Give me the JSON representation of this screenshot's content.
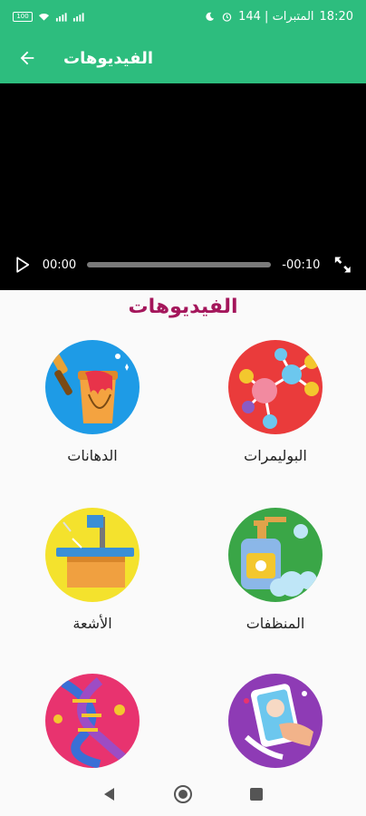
{
  "status_bar": {
    "time": "18:20",
    "carrier": "144 | المتبرات",
    "battery": "100"
  },
  "app_bar": {
    "title": "الفيديوهات",
    "back_icon": "arrow-left-icon"
  },
  "player": {
    "current_time": "00:00",
    "remaining_time": "-00:10",
    "progress": 0,
    "play_icon": "play-icon",
    "fullscreen_icon": "fullscreen-icon"
  },
  "section": {
    "title": "الفيديوهات"
  },
  "categories": [
    {
      "label": "الدهانات",
      "icon": "paint-bucket-icon",
      "color": "#1e9be6"
    },
    {
      "label": "البوليمرات",
      "icon": "molecule-icon",
      "color": "#ea3b3b"
    },
    {
      "label": "الأشعة",
      "icon": "xray-table-icon",
      "color": "#f4e22d"
    },
    {
      "label": "المنظفات",
      "icon": "soap-bottle-icon",
      "color": "#3aa647"
    },
    {
      "label": "",
      "icon": "dna-icon",
      "color": "#e8336f"
    },
    {
      "label": "",
      "icon": "hand-card-icon",
      "color": "#8e3bb5"
    }
  ],
  "nav": {
    "back_icon": "nav-back-icon",
    "home_icon": "nav-home-icon",
    "recents_icon": "nav-recents-icon"
  },
  "colors": {
    "primary": "#2dbd7e",
    "section_title": "#a4165b"
  }
}
